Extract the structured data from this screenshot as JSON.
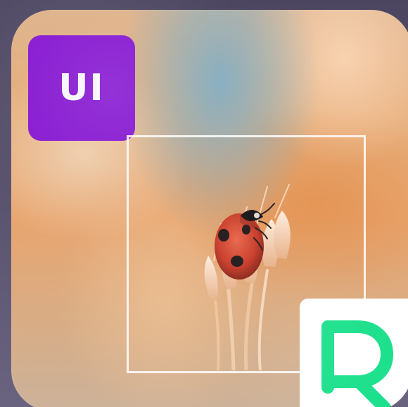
{
  "app_icon": {
    "badge_text": "UI",
    "badge_color": "#8b21d3",
    "logo_color": "#1ce08c",
    "icon_names": [
      "ladybug-photo",
      "crop-frame",
      "r-logo"
    ]
  }
}
